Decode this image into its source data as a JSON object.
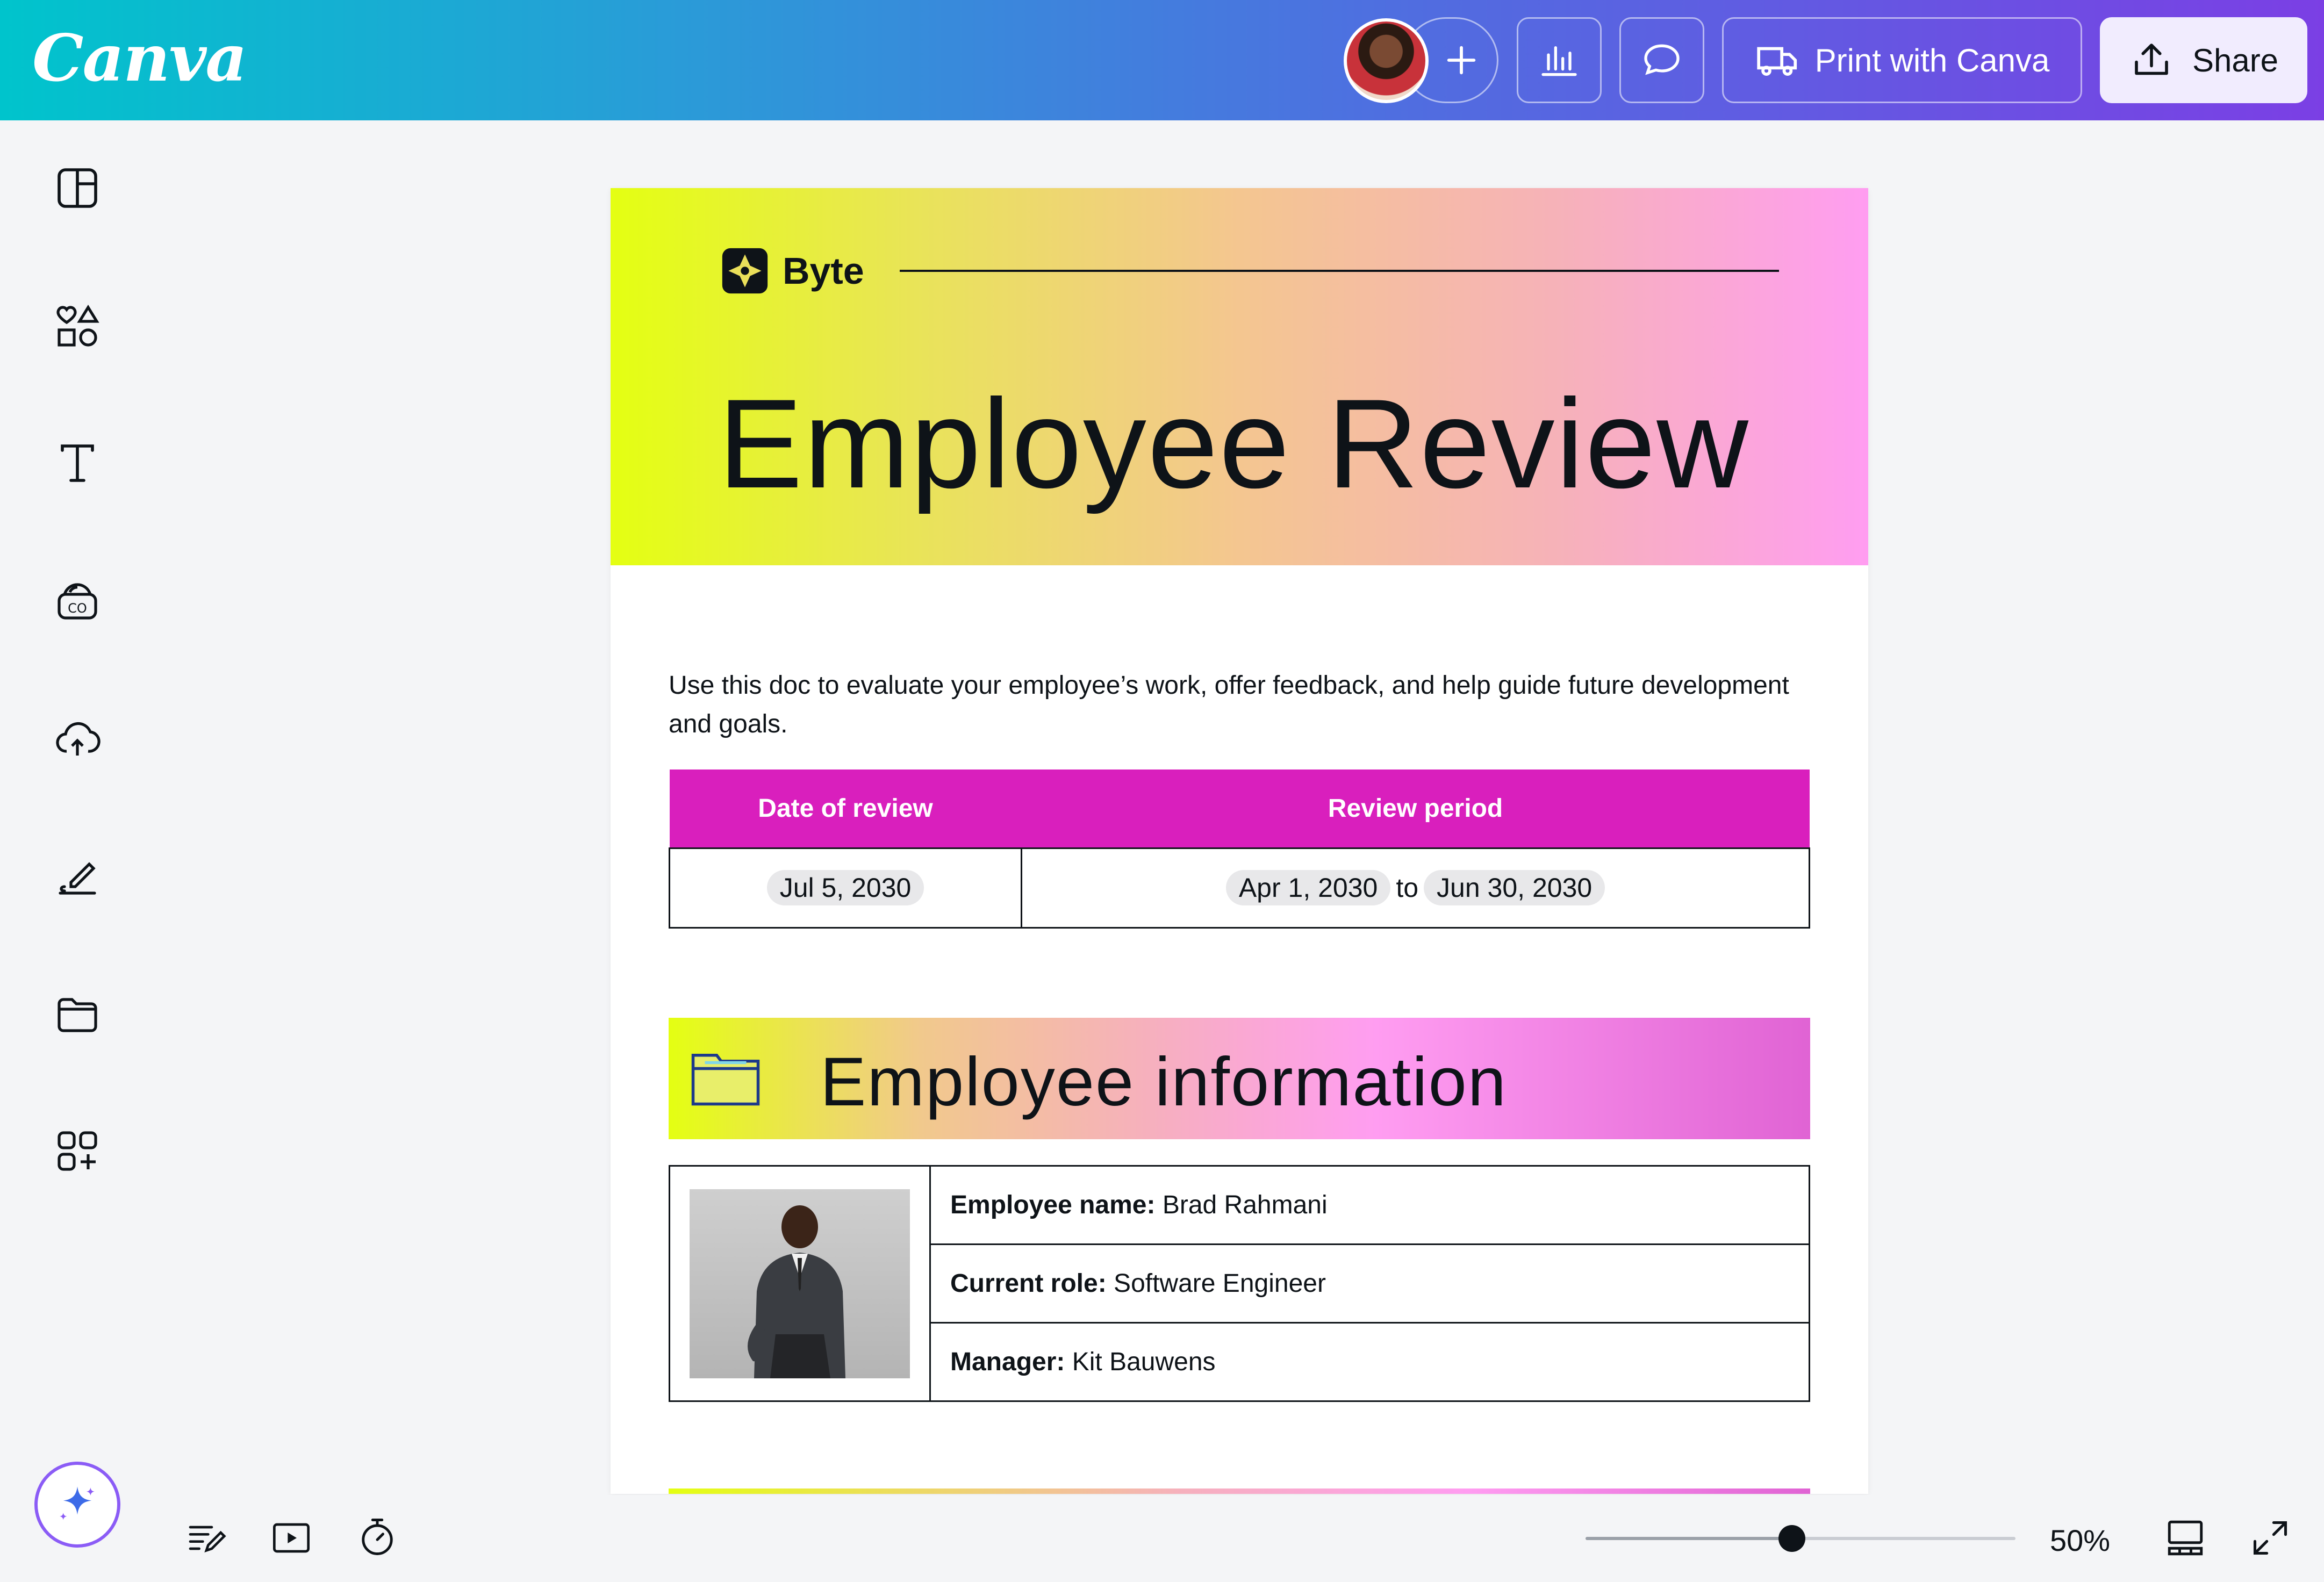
{
  "app": {
    "logo": "Canva",
    "accent": "#7b3fe4",
    "brand_teal": "#00c4cc"
  },
  "header": {
    "print_label": "Print with Canva",
    "share_label": "Share",
    "icons": [
      "add-icon",
      "analytics-icon",
      "comment-icon",
      "truck-icon",
      "upload-icon"
    ]
  },
  "sidebar": {
    "items": [
      "design-icon",
      "elements-icon",
      "text-icon",
      "brand-icon",
      "uploads-icon",
      "draw-icon",
      "projects-icon",
      "apps-icon"
    ]
  },
  "document": {
    "brand_name": "Byte",
    "title": "Employee Review",
    "intro": "Use this doc to evaluate your employee’s work, offer feedback, and help guide future development and goals.",
    "review": {
      "header_date": "Date of review",
      "header_period": "Review period",
      "date": "Jul 5, 2030",
      "period_start": "Apr 1, 2030",
      "period_to": "to",
      "period_end": "Jun 30, 2030",
      "header_color": "#d91fbd"
    },
    "employee_section": {
      "title": "Employee information",
      "name_label": "Employee name:",
      "name_value": "Brad Rahmani",
      "role_label": "Current role:",
      "role_value": "Software Engineer",
      "manager_label": "Manager:",
      "manager_value": "Kit Bauwens"
    }
  },
  "footer": {
    "zoom": "50%",
    "zoom_fraction": 0.48,
    "icons": [
      "notes-icon",
      "present-icon",
      "timer-icon",
      "grid-view-icon",
      "fullscreen-icon"
    ]
  }
}
